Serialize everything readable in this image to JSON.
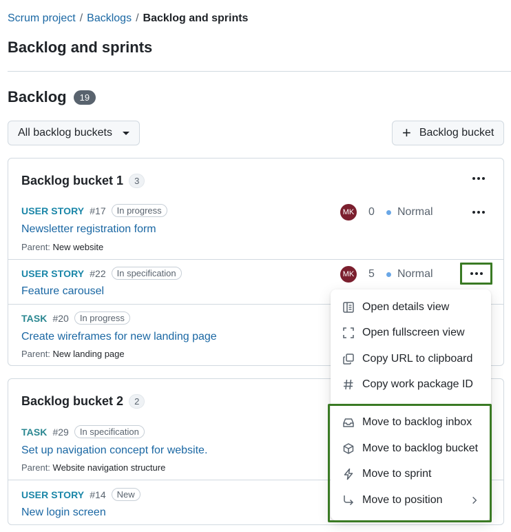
{
  "breadcrumb": {
    "items": [
      "Scrum project",
      "Backlogs"
    ],
    "separator": "/",
    "current": "Backlog and sprints"
  },
  "page_title": "Backlog and sprints",
  "backlog": {
    "title": "Backlog",
    "count": "19",
    "filter_label": "All backlog buckets",
    "add_bucket_label": "Backlog bucket"
  },
  "buckets": [
    {
      "name": "Backlog bucket 1",
      "count": "3",
      "items": [
        {
          "type": "USER STORY",
          "id": "#17",
          "status": "In progress",
          "subject": "Newsletter registration form",
          "parent_label": "Parent:",
          "parent": "New website",
          "assignee": "MK",
          "points": "0",
          "priority": "Normal"
        },
        {
          "type": "USER STORY",
          "id": "#22",
          "status": "In specification",
          "subject": "Feature carousel",
          "assignee": "MK",
          "points": "5",
          "priority": "Normal"
        },
        {
          "type": "TASK",
          "id": "#20",
          "status": "In progress",
          "subject": "Create wireframes for new landing page",
          "parent_label": "Parent:",
          "parent": "New landing page"
        }
      ]
    },
    {
      "name": "Backlog bucket 2",
      "count": "2",
      "items": [
        {
          "type": "TASK",
          "id": "#29",
          "status": "In specification",
          "subject": "Set up navigation concept for website.",
          "parent_label": "Parent:",
          "parent": "Website navigation structure"
        },
        {
          "type": "USER STORY",
          "id": "#14",
          "status": "New",
          "subject": "New login screen"
        }
      ]
    }
  ],
  "context_menu": {
    "items": [
      {
        "label": "Open details view",
        "icon": "details-view-icon"
      },
      {
        "label": "Open fullscreen view",
        "icon": "fullscreen-icon"
      },
      {
        "label": "Copy URL to clipboard",
        "icon": "copy-icon"
      },
      {
        "label": "Copy work package ID",
        "icon": "hash-icon"
      },
      {
        "label": "Move to backlog inbox",
        "icon": "inbox-icon"
      },
      {
        "label": "Move to backlog bucket",
        "icon": "package-icon"
      },
      {
        "label": "Move to sprint",
        "icon": "zap-icon"
      },
      {
        "label": "Move to position",
        "icon": "arrow-turn-icon"
      }
    ]
  },
  "colors": {
    "link": "#1a67a3",
    "user_story": "#1a86a8",
    "task": "#2a8791",
    "avatar": "#7b1f2e",
    "priority_dot": "#6aa7e6",
    "highlight": "#3a7a24"
  }
}
